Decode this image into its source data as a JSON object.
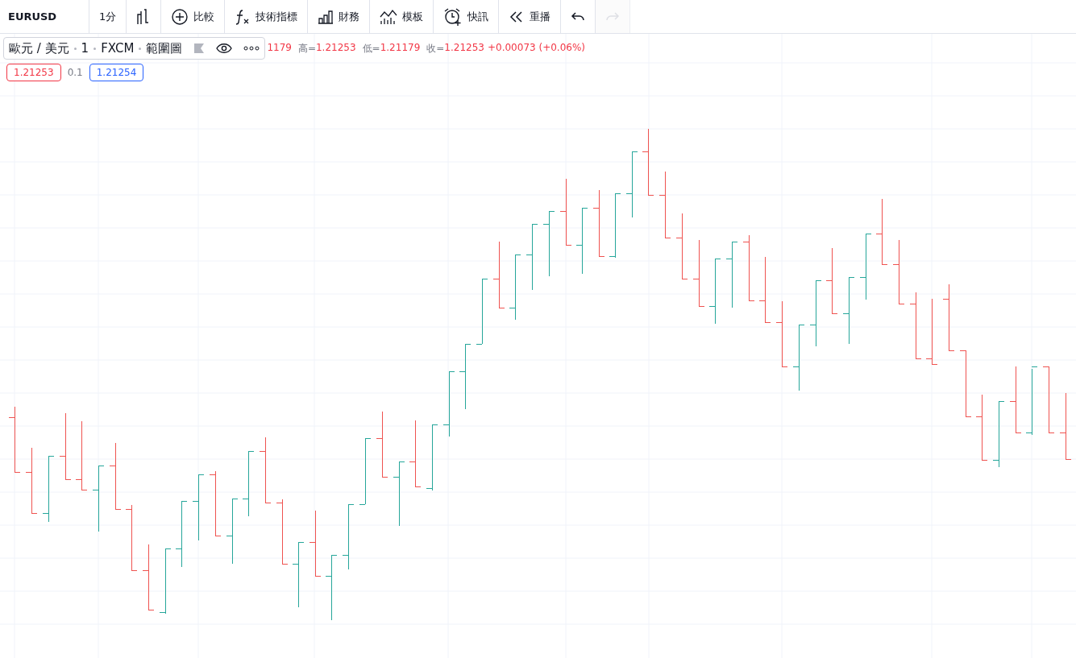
{
  "toolbar": {
    "symbol": "EURUSD",
    "items": [
      {
        "kind": "interval",
        "label": "1分",
        "disabled": false
      },
      {
        "kind": "bar-style",
        "disabled": false
      },
      {
        "kind": "compare",
        "label": "比較",
        "disabled": false
      },
      {
        "kind": "indicators",
        "label": "技術指標",
        "disabled": false
      },
      {
        "kind": "financials",
        "label": "財務",
        "disabled": false
      },
      {
        "kind": "templates",
        "label": "模板",
        "disabled": false
      },
      {
        "kind": "alert",
        "label": "快訊",
        "disabled": false
      },
      {
        "kind": "replay",
        "label": "重播",
        "disabled": false
      },
      {
        "kind": "undo",
        "disabled": false
      },
      {
        "kind": "redo",
        "disabled": true
      }
    ]
  },
  "legend": {
    "pair": "歐元 / 美元",
    "interval": "1",
    "source": "FXCM",
    "style": "範圍圖",
    "ohlc": [
      {
        "value": "1179"
      },
      {
        "label": "高=",
        "value": "1.21253"
      },
      {
        "label": "低=",
        "value": "1.21179"
      },
      {
        "label": "收=",
        "value": "1.21253"
      }
    ],
    "change": "+0.00073 (+0.06%)"
  },
  "quote": {
    "bid": "1.21253",
    "spread": "0.1",
    "ask": "1.21254"
  }
}
